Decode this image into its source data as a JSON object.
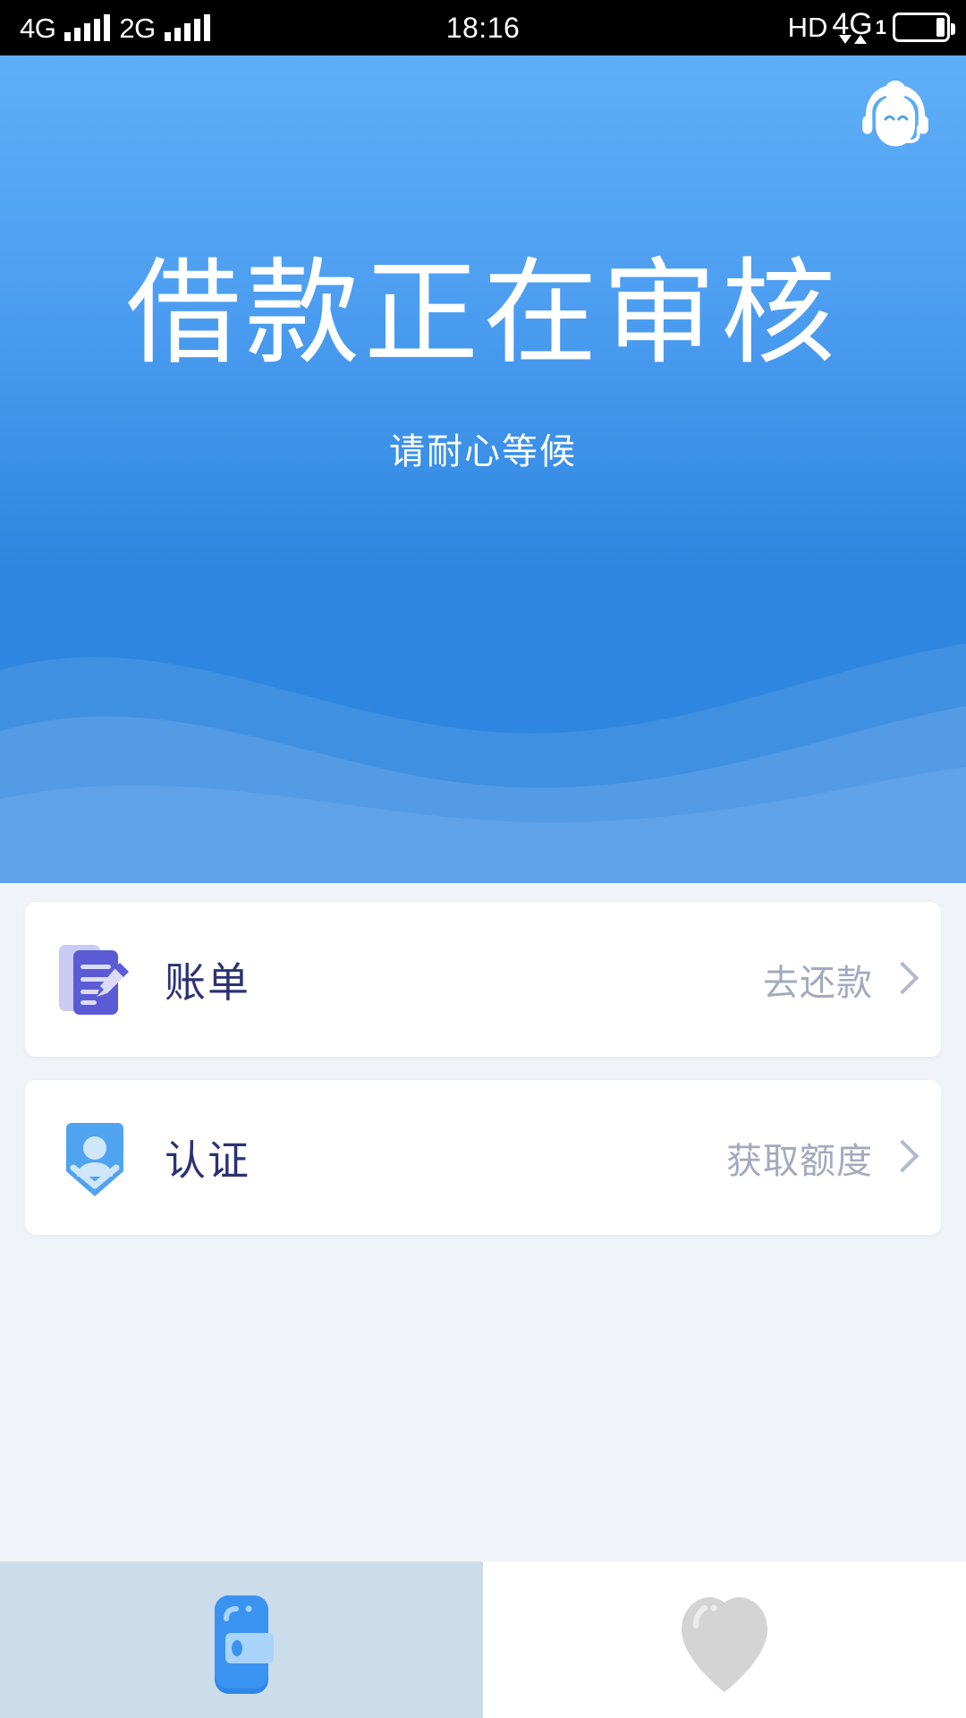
{
  "status_bar": {
    "sim1_network": "4G",
    "sim2_network": "2G",
    "time": "18:16",
    "hd_label": "HD",
    "data_network": "4G",
    "sim_index": "1",
    "signal_bars": 5,
    "battery_level_pct": 15,
    "background_color": "#000000",
    "text_color": "#FFFFFF"
  },
  "hero": {
    "title": "借款正在审核",
    "subtitle": "请耐心等候",
    "support_icon": "customer-service-icon",
    "gradient_top_color": "#5FAEF7",
    "gradient_bottom_color": "#2E85E0",
    "text_color": "#FFFFFF"
  },
  "cards": [
    {
      "icon": "bill-document-pencil-icon",
      "title": "账单",
      "action_label": "去还款",
      "chevron": "chevron-right-icon",
      "icon_color": "#5B5BD6",
      "title_color": "#2B3274",
      "action_color": "#A3A9BF"
    },
    {
      "icon": "shield-person-verify-icon",
      "title": "认证",
      "action_label": "获取额度",
      "chevron": "chevron-right-icon",
      "icon_color": "#4FA3EF",
      "title_color": "#2B3274",
      "action_color": "#A3A9BF"
    }
  ],
  "bottom_nav": {
    "items": [
      {
        "icon": "wallet-icon",
        "label": "",
        "active": true,
        "active_background": "#CBDCEA",
        "icon_color": "#2E86E8"
      },
      {
        "icon": "heart-icon",
        "label": "",
        "active": false,
        "active_background": "#FFFFFF",
        "icon_color": "#D4D4D4"
      }
    ]
  },
  "page": {
    "background_color": "#F0F4F8",
    "card_background_color": "#FFFFFF"
  }
}
